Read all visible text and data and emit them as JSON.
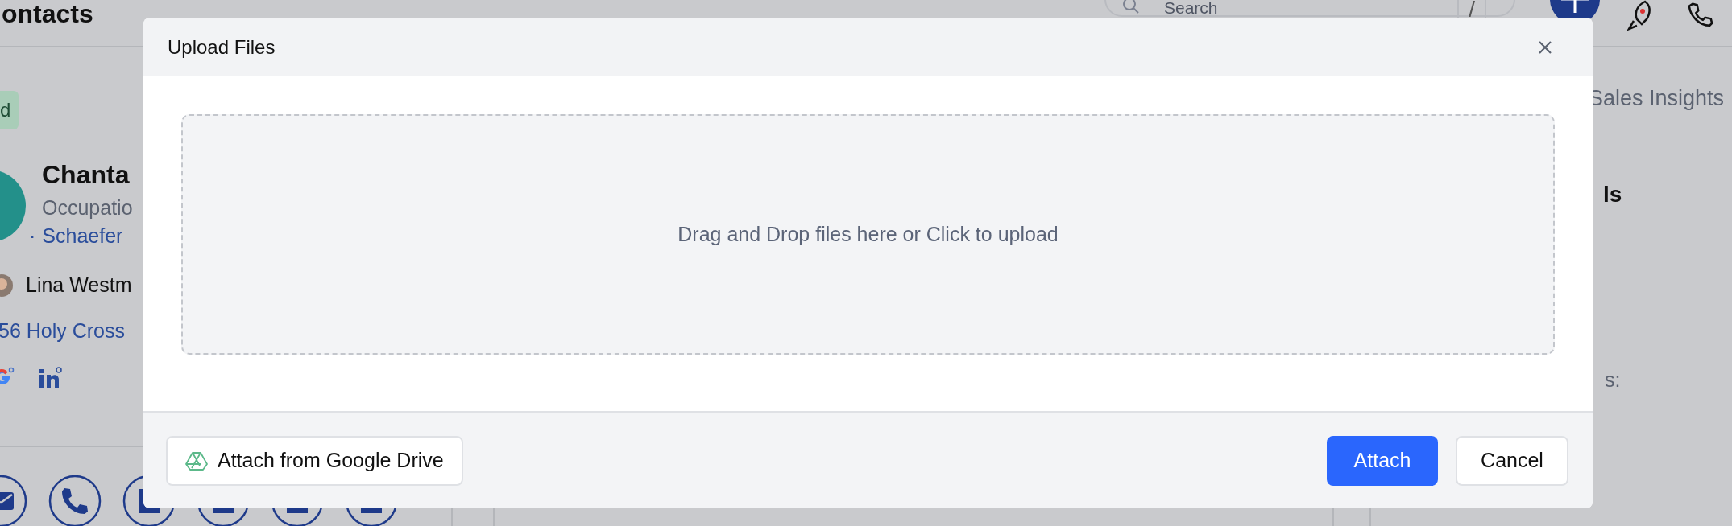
{
  "background_page": {
    "title": "ontacts",
    "search": {
      "placeholder": "Search"
    },
    "shortcut_key": "/",
    "tag": "d",
    "contact": {
      "name": "Chanta",
      "occupation": "Occupatio",
      "bullet": "·",
      "company": "Schaefer",
      "owner": "Lina Westm",
      "address": "56 Holy Cross"
    },
    "right_panel": {
      "tab": "Sales Insights",
      "heading": "ls",
      "label": "s:"
    }
  },
  "dialog": {
    "title": "Upload Files",
    "dropzone": {
      "text": "Drag and Drop files here or Click to upload"
    },
    "buttons": [
      {
        "label": "Attach from Google Drive",
        "kind": "drive"
      },
      {
        "label": "Attach",
        "kind": "primary"
      },
      {
        "label": "Cancel",
        "kind": "secondary"
      }
    ]
  }
}
